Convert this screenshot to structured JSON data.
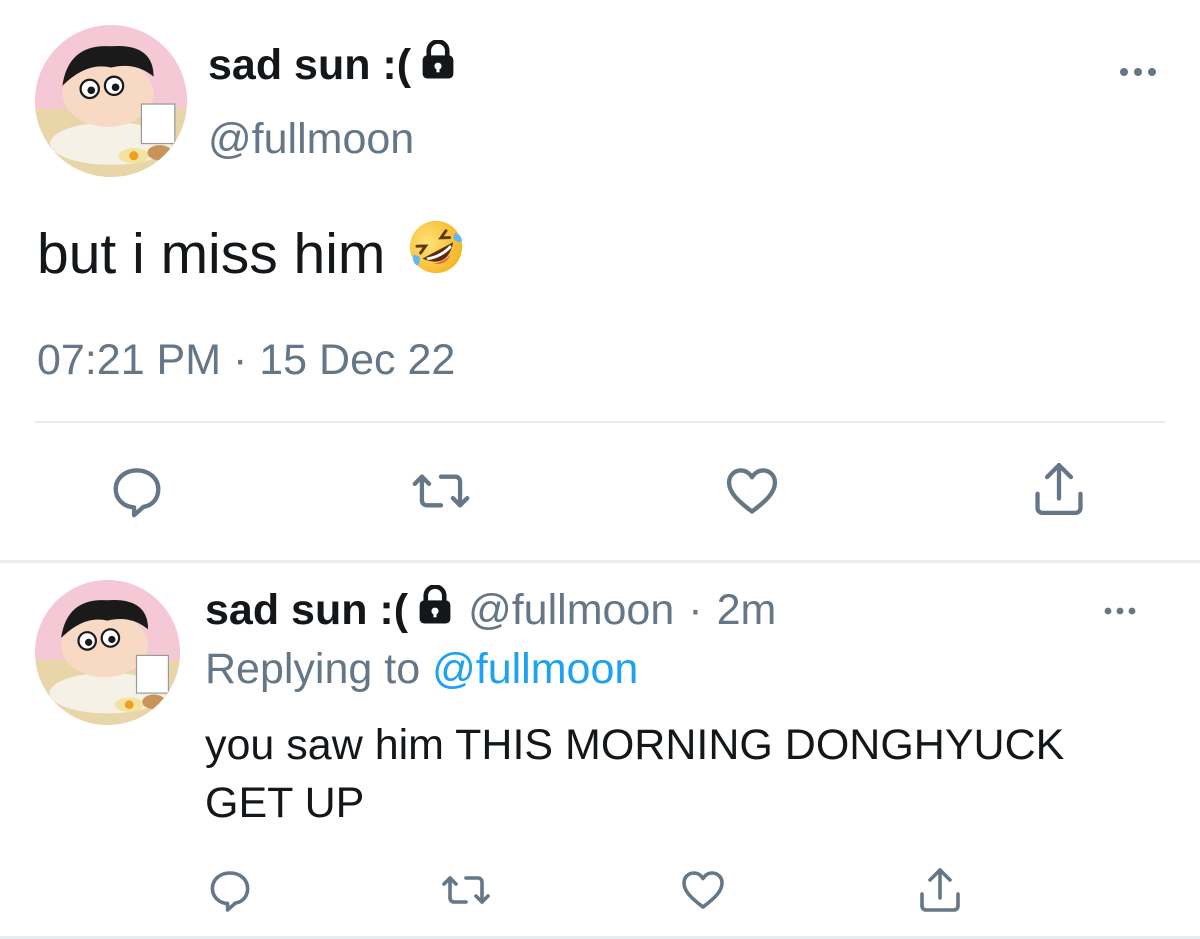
{
  "main_tweet": {
    "display_name": "sad sun :(",
    "handle": "@fullmoon",
    "text": "but i miss him",
    "emoji": "rolling-on-floor-laughing",
    "timestamp": "07:21 PM · 15 Dec 22",
    "icons": {
      "reply": "reply-icon",
      "retweet": "retweet-icon",
      "like": "heart-icon",
      "share": "share-icon",
      "more": "more-options-icon",
      "lock": "lock-icon"
    }
  },
  "reply_tweet": {
    "display_name": "sad sun :(",
    "handle": "@fullmoon",
    "separator": "·",
    "age": "2m",
    "replying_to_label": "Replying to",
    "replying_to_handle": "@fullmoon",
    "text": "you saw him THIS MORNING DONGHYUCK GET UP"
  },
  "colors": {
    "text": "#14171a",
    "secondary": "#657786",
    "link": "#1da1f2",
    "divider": "#e6ecf0"
  }
}
